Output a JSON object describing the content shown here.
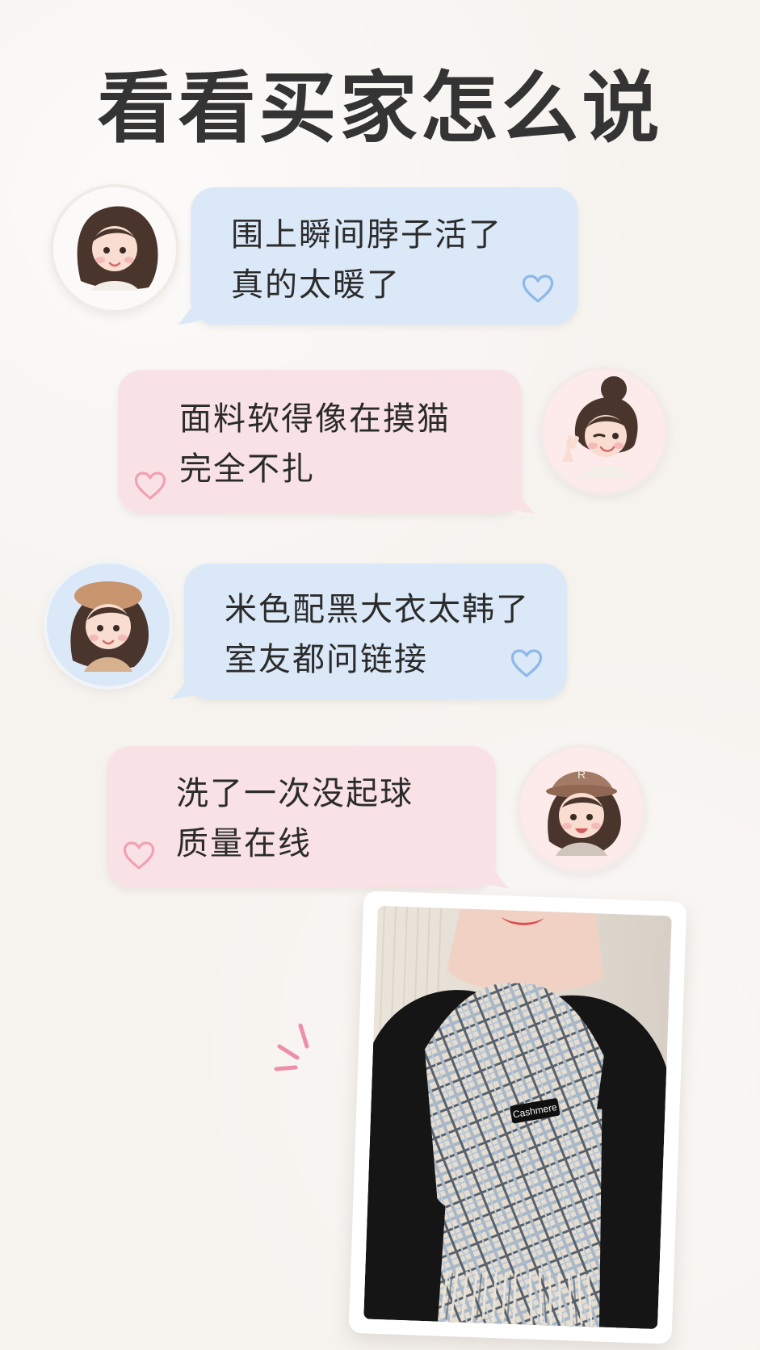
{
  "page": {
    "title": "看看买家怎么说"
  },
  "comments": [
    {
      "line1": "围上瞬间脖子活了",
      "line2": "真的太暖了"
    },
    {
      "line1": "面料软得像在摸猫",
      "line2": "完全不扎"
    },
    {
      "line1": "米色配黑大衣太韩了",
      "line2": "室友都问链接"
    },
    {
      "line1": "洗了一次没起球",
      "line2": "质量在线"
    }
  ],
  "photo": {
    "tag": "Cashmere"
  },
  "colors": {
    "background": "#f6f3ef",
    "blue_bubble": "#dbe8f8",
    "pink_bubble": "#f9e2e6",
    "blue_heart": "#8db8ea",
    "pink_heart": "#f2a1b4",
    "title_text": "#343434"
  },
  "icons": {
    "heart": "heart-icon",
    "sparkle": "sparkle-icon"
  }
}
